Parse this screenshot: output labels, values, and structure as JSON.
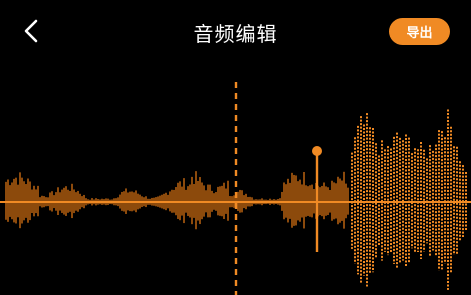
{
  "colors": {
    "background": "#000000",
    "accent": "#F08A24",
    "waveform_dim": "#C86A12",
    "text": "#FFFFFF"
  },
  "header": {
    "back_icon": "chevron-left-icon",
    "title": "音频编辑",
    "export_label": "导出"
  },
  "editor": {
    "position_marker": "dashed-playhead-line",
    "trim_handle_position": 0.674,
    "playhead_position": 0.503
  }
}
